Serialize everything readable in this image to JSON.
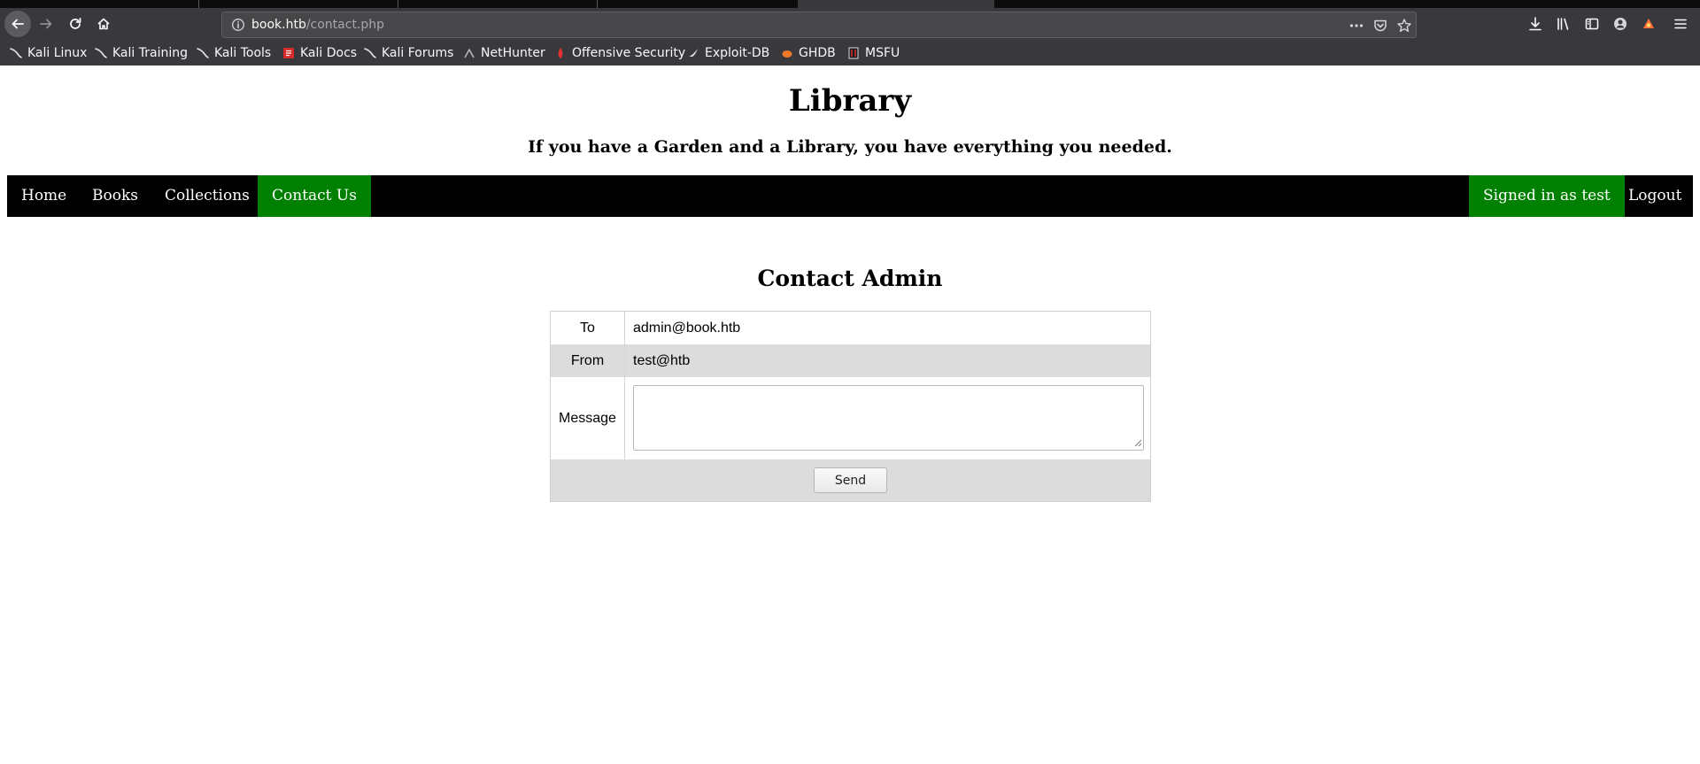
{
  "browser": {
    "url_host": "book.htb",
    "url_path": "/contact.php",
    "bookmarks": [
      {
        "label": "Kali Linux",
        "icon": "kali-dragon-icon"
      },
      {
        "label": "Kali Training",
        "icon": "kali-dragon-icon"
      },
      {
        "label": "Kali Tools",
        "icon": "kali-dragon-icon"
      },
      {
        "label": "Kali Docs",
        "icon": "kali-docs-icon"
      },
      {
        "label": "Kali Forums",
        "icon": "kali-dragon-icon"
      },
      {
        "label": "NetHunter",
        "icon": "nethunter-icon"
      },
      {
        "label": "Offensive Security",
        "icon": "offsec-icon"
      },
      {
        "label": "Exploit-DB",
        "icon": "exploit-db-icon"
      },
      {
        "label": "GHDB",
        "icon": "ghdb-icon"
      },
      {
        "label": "MSFU",
        "icon": "msfu-icon"
      }
    ]
  },
  "site": {
    "title": "Library",
    "tagline": "If you have a Garden and a Library, you have everything you needed."
  },
  "nav": {
    "items": [
      "Home",
      "Books",
      "Collections",
      "Contact Us"
    ],
    "active": "Contact Us",
    "signed_in": "Signed in as test",
    "logout": "Logout"
  },
  "contact": {
    "heading": "Contact Admin",
    "to_label": "To",
    "to_value": "admin@book.htb",
    "from_label": "From",
    "from_value": "test@htb",
    "message_label": "Message",
    "message_value": "",
    "send_label": "Send"
  },
  "colors": {
    "chrome_bg": "#38383d",
    "nav_bg": "#000000",
    "nav_active": "#008000",
    "row_alt": "#dcdcdc"
  }
}
